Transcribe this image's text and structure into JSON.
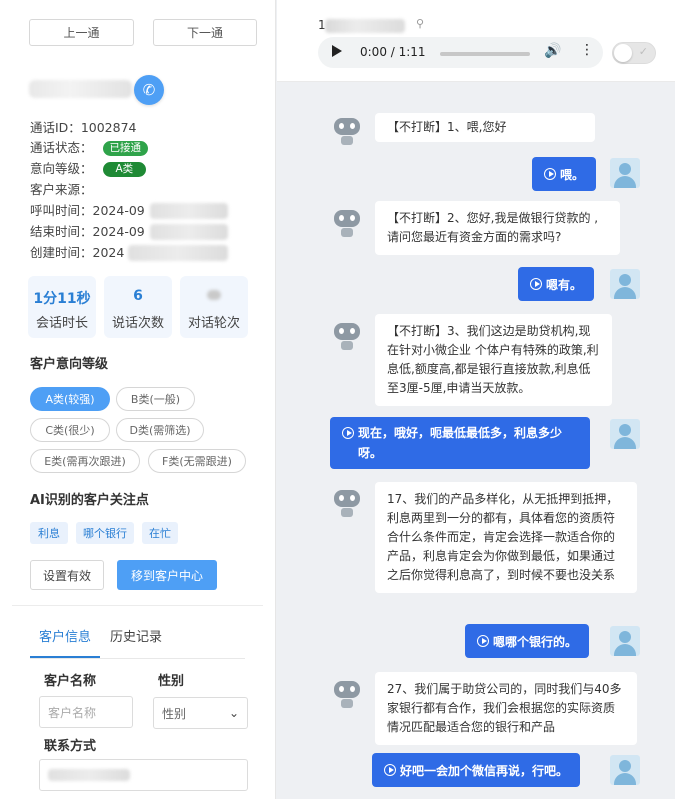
{
  "nav": {
    "prev": "上一通",
    "next": "下一通"
  },
  "call": {
    "id_label": "通话ID：",
    "id_value": "1002874",
    "status_label": "通话状态：",
    "status_value": "已接通",
    "intent_label": "意向等级：",
    "intent_value": "A类",
    "source_label": "客户来源：",
    "source_value": "",
    "call_time_label": "呼叫时间：",
    "call_time_value": "2024-09",
    "end_time_label": "结束时间：",
    "end_time_value": "2024-09",
    "create_time_label": "创建时间：",
    "create_time_value": "2024"
  },
  "stats": [
    {
      "value": "1分11秒",
      "label": "会话时长"
    },
    {
      "value": "6",
      "label": "说话次数"
    },
    {
      "value": "",
      "label": "对话轮次"
    }
  ],
  "intent_section": {
    "title": "客户意向等级",
    "levels": [
      "A类(较强)",
      "B类(一般)",
      "C类(很少)",
      "D类(需筛选)",
      "E类(需再次跟进)",
      "F类(无需跟进)"
    ],
    "selected": "A类(较强)"
  },
  "focus_section": {
    "title": "AI识别的客户关注点",
    "tags": [
      "利息",
      "哪个银行",
      "在忙"
    ]
  },
  "actions": {
    "set_valid": "设置有效",
    "move_to_center": "移到客户中心"
  },
  "tabs": {
    "customer_info": "客户信息",
    "history": "历史记录"
  },
  "form": {
    "name_label": "客户名称",
    "name_placeholder": "客户名称",
    "gender_label": "性别",
    "gender_value": "性别",
    "contact_label": "联系方式"
  },
  "header": {
    "phone_prefix": "1"
  },
  "audio": {
    "time": "0:00 / 1:11",
    "progress": 0.0
  },
  "messages": [
    {
      "role": "bot",
      "text": "【不打断】1、喂,您好"
    },
    {
      "role": "user",
      "text": "喂。"
    },
    {
      "role": "bot",
      "text": "【不打断】2、您好,我是做银行贷款的 ,请问您最近有资金方面的需求吗?"
    },
    {
      "role": "user",
      "text": "嗯有。"
    },
    {
      "role": "bot",
      "text": "【不打断】3、我们这边是助贷机构,现在针对小微企业 个体户有特殊的政策,利息低,额度高,都是银行直接放款,利息低至3厘-5厘,申请当天放款。"
    },
    {
      "role": "user",
      "text": "现在，哦好，呃最低最低多，利息多少呀。"
    },
    {
      "role": "bot",
      "text": "17、我们的产品多样化，从无抵押到抵押，利息两里到一分的都有，具体看您的资质符合什么条件而定，肯定会选择一款适合你的产品，利息肯定会为你做到最低，如果通过之后你觉得利息高了，到时候不要也没关系"
    },
    {
      "role": "user",
      "text": "嗯哪个银行的。"
    },
    {
      "role": "bot",
      "text": "27、我们属于助贷公司的，同时我们与40多家银行都有合作，我们会根据您的实际资质情况匹配最适合您的银行和产品"
    },
    {
      "role": "user",
      "text": "好吧一会加个微信再说，行吧。"
    }
  ]
}
